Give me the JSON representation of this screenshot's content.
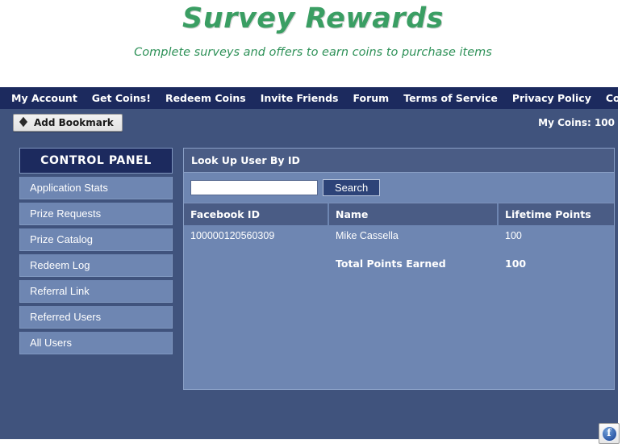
{
  "masthead": {
    "title": "Survey Rewards",
    "tagline": "Complete surveys and offers to earn coins to purchase items",
    "title_color": "#3a9e63",
    "tagline_color": "#2e9158"
  },
  "nav": {
    "items": [
      {
        "label": "My Account"
      },
      {
        "label": "Get Coins!"
      },
      {
        "label": "Redeem Coins"
      },
      {
        "label": "Invite Friends"
      },
      {
        "label": "Forum"
      },
      {
        "label": "Terms of Service"
      },
      {
        "label": "Privacy Policy"
      },
      {
        "label": "Control Panel"
      }
    ],
    "background": "#1c2a5e"
  },
  "subbar": {
    "bookmark_label": "Add Bookmark",
    "bookmark_icon": "bookmark-diamond-icon",
    "coins_label": "My Coins: 100",
    "background": "#40537d"
  },
  "sidebar": {
    "header": "CONTROL PANEL",
    "items": [
      {
        "label": "Application Stats"
      },
      {
        "label": "Prize Requests"
      },
      {
        "label": "Prize Catalog"
      },
      {
        "label": "Redeem Log"
      },
      {
        "label": "Referral Link"
      },
      {
        "label": "Referred Users"
      },
      {
        "label": "All Users"
      }
    ],
    "item_background": "#6e86b2",
    "header_background": "#1c2a5e"
  },
  "main": {
    "panel_title": "Look Up User By ID",
    "search": {
      "value": "",
      "placeholder": "",
      "button_label": "Search"
    },
    "table": {
      "columns": [
        "Facebook ID",
        "Name",
        "Lifetime Points"
      ],
      "rows": [
        {
          "facebook_id": "100000120560309",
          "name": "Mike Cassella",
          "lifetime_points": "100"
        }
      ],
      "total_label": "Total Points Earned",
      "total_value": "100"
    },
    "panel_background": "#6e86b2",
    "header_background": "#4a5c85"
  },
  "footer": {
    "badge_icon": "facebook-globe-icon"
  }
}
